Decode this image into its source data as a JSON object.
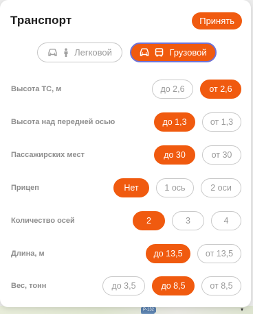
{
  "header": {
    "title": "Транспорт",
    "accept_label": "Принять"
  },
  "modes": {
    "car": {
      "label": "Легковой",
      "selected": false,
      "icons": [
        "car-icon",
        "person-icon"
      ]
    },
    "truck": {
      "label": "Грузовой",
      "selected": true,
      "icons": [
        "truck-icon",
        "bus-icon"
      ]
    }
  },
  "rows": [
    {
      "label": "Высота ТС, м",
      "options": [
        {
          "text": "до 2,6",
          "selected": false
        },
        {
          "text": "от 2,6",
          "selected": true
        }
      ]
    },
    {
      "label": "Высота над передней осью",
      "options": [
        {
          "text": "до 1,3",
          "selected": true
        },
        {
          "text": "от 1,3",
          "selected": false
        }
      ]
    },
    {
      "label": "Пассажирских мест",
      "options": [
        {
          "text": "до 30",
          "selected": true
        },
        {
          "text": "от 30",
          "selected": false
        }
      ]
    },
    {
      "label": "Прицеп",
      "options": [
        {
          "text": "Нет",
          "selected": true
        },
        {
          "text": "1 ось",
          "selected": false
        },
        {
          "text": "2 оси",
          "selected": false
        }
      ]
    },
    {
      "label": "Количество осей",
      "options": [
        {
          "text": "2",
          "selected": true
        },
        {
          "text": "3",
          "selected": false
        },
        {
          "text": "4",
          "selected": false
        }
      ]
    },
    {
      "label": "Длина, м",
      "options": [
        {
          "text": "до 13,5",
          "selected": true
        },
        {
          "text": "от 13,5",
          "selected": false
        }
      ]
    },
    {
      "label": "Вес, тонн",
      "options": [
        {
          "text": "до 3,5",
          "selected": false
        },
        {
          "text": "до 8,5",
          "selected": true
        },
        {
          "text": "от 8,5",
          "selected": false
        }
      ]
    }
  ],
  "map": {
    "road_badge": "Р-132"
  },
  "colors": {
    "accent": "#f05a0f",
    "focus_ring": "#6e72d6",
    "muted_text": "#8e8e8e"
  }
}
